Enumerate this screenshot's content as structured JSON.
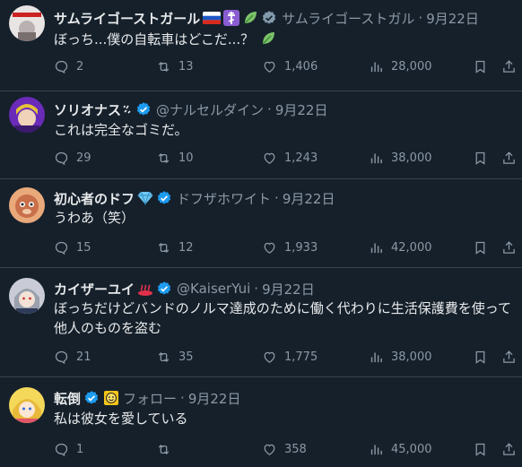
{
  "tweets": [
    {
      "name": "サムライゴーストガール",
      "badges": [
        "ru-flag-emoji",
        "orthodox-cross-emoji",
        "leaf-emoji"
      ],
      "handle": "サムライゴーストガル",
      "date": "9月22日",
      "text": "ぼっち...僕の自転車はどこだ...？",
      "text_emoji": "leaf-emoji",
      "replies": "2",
      "retweets": "13",
      "likes": "1,406",
      "views": "28,000"
    },
    {
      "name": "ソリオナス",
      "badges": [
        "sparkle-emoji"
      ],
      "verified": true,
      "handle": "@ナルセルダイン",
      "date": "9月22日",
      "text": "これは完全なゴミだ。",
      "replies": "29",
      "retweets": "10",
      "likes": "1,243",
      "views": "38,000"
    },
    {
      "name": "初心者のドフ",
      "badges": [
        "gem-emoji"
      ],
      "verified": true,
      "handle": "ドフザホワイト",
      "date": "9月22日",
      "text": "うわあ（笑）",
      "replies": "15",
      "retweets": "12",
      "likes": "1,933",
      "views": "42,000"
    },
    {
      "name": "カイザーユイ",
      "badges": [
        "hot-springs-emoji"
      ],
      "verified": true,
      "handle": "@KaiserYui",
      "date": "9月22日",
      "text": "ぼっちだけどバンドのノルマ達成のために働く代わりに生活保護費を使って他人のものを盗む",
      "replies": "21",
      "retweets": "35",
      "likes": "1,775",
      "views": "38,000"
    },
    {
      "name": "転倒",
      "badges": [
        "smiley-emoji"
      ],
      "verified": true,
      "handle": "フォロー",
      "date": "9月22日",
      "text": "私は彼女を愛している",
      "replies": "1",
      "retweets": "",
      "likes": "358",
      "views": "45,000"
    }
  ],
  "colors": {
    "background": "#15202b",
    "text": "#e7e9ea",
    "muted": "#8b98a5",
    "verified": "#1d9bf0",
    "divider": "#38444d"
  }
}
